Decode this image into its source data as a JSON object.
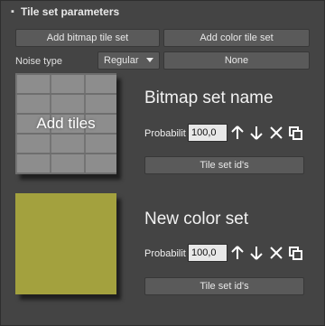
{
  "rollout": {
    "toggle_glyph": "▪",
    "title": "Tile set parameters"
  },
  "buttons": {
    "add_bitmap": "Add bitmap tile set",
    "add_color": "Add color tile set",
    "none": "None"
  },
  "noise": {
    "label": "Noise type",
    "selected": "Regular"
  },
  "tile_sets": [
    {
      "thumbnail_text": "Add tiles",
      "name": "Bitmap set name",
      "probability_label": "Probabilit",
      "probability_value": "100,0",
      "ids_button": "Tile set id's"
    },
    {
      "thumbnail_color": "#a3a13e",
      "name": "New color set",
      "probability_label": "Probabilit",
      "probability_value": "100,0",
      "ids_button": "Tile set id's"
    }
  ]
}
